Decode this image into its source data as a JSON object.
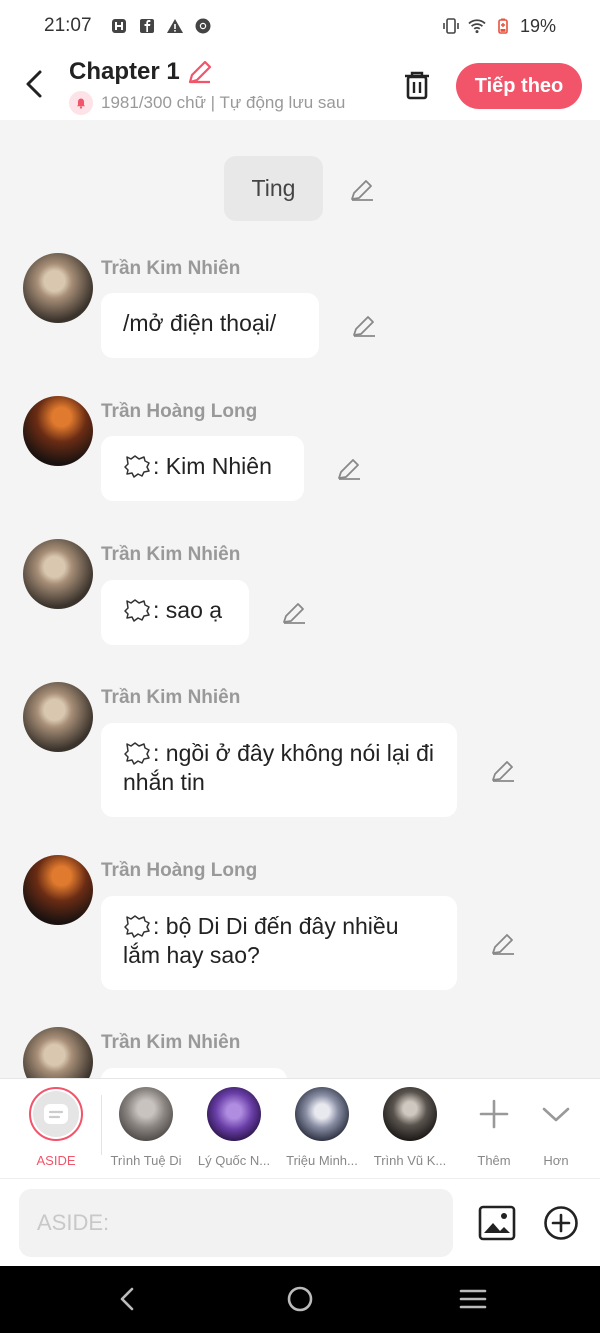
{
  "status": {
    "time": "21:07",
    "battery": "19%"
  },
  "header": {
    "title": "Chapter 1",
    "subtitle": "1981/300 chữ | Tự động lưu sau",
    "next_label": "Tiếp theo"
  },
  "chat": {
    "narration": "Ting",
    "messages": [
      {
        "sender": "Trần Kim Nhiên",
        "text": "/mở điện thoại/",
        "has_icon": false
      },
      {
        "sender": "Trần Hoàng Long",
        "text": ": Kim Nhiên",
        "has_icon": true
      },
      {
        "sender": "Trần Kim Nhiên",
        "text": ": sao ạ",
        "has_icon": true
      },
      {
        "sender": "Trần Kim Nhiên",
        "text": ": ngồi ở đây không nói lại đi nhắn tin",
        "has_icon": true
      },
      {
        "sender": "Trần Hoàng Long",
        "text": ": bộ Di Di đến đây nhiều lắm hay sao?",
        "has_icon": true
      },
      {
        "sender": "Trần Kim Nhiên",
        "text": "",
        "has_icon": false
      }
    ]
  },
  "characters": {
    "aside_label": "ASIDE",
    "items": [
      {
        "label": "Trình Tuệ Di"
      },
      {
        "label": "Lý Quốc N..."
      },
      {
        "label": "Triệu Minh..."
      },
      {
        "label": "Trình Vũ K..."
      }
    ],
    "add_label": "Thêm",
    "more_label": "Hơn"
  },
  "input": {
    "placeholder": "ASIDE:"
  },
  "colors": {
    "accent": "#f2546a",
    "background": "#f4f4f4"
  }
}
